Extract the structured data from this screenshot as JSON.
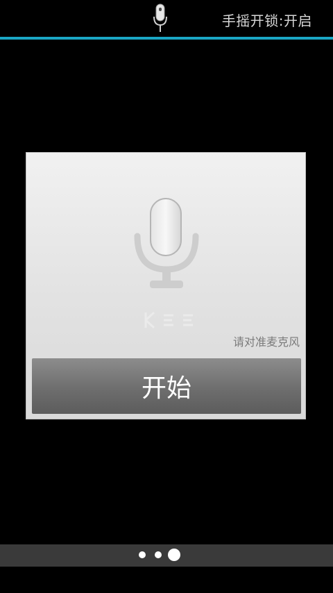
{
  "status_bar": {
    "mic_icon": "microphone-icon",
    "shake_unlock_text": "手摇开锁:开启",
    "accent_color": "#1aa6c4"
  },
  "voice_card": {
    "mic_icon": "microphone-icon",
    "hint": "请对准麦克风",
    "start_label": "开始"
  },
  "page_indicator": {
    "total_pages": 3,
    "current_page": 3
  }
}
